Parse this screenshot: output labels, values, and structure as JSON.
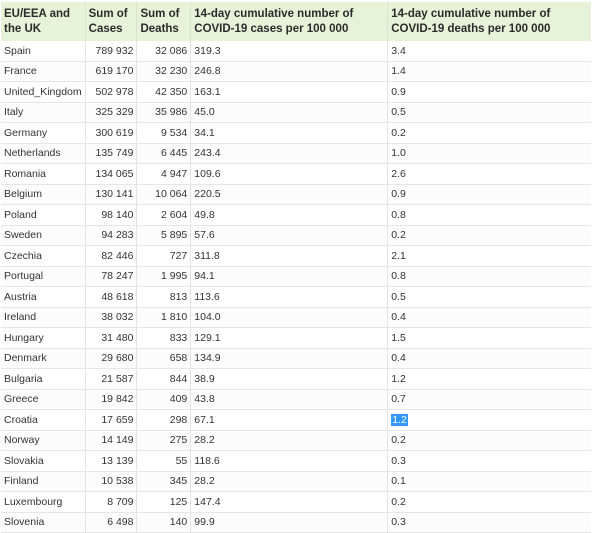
{
  "headers": {
    "country": "EU/EEA and the UK",
    "cases": "Sum of Cases",
    "deaths": "Sum of Deaths",
    "cases_rate": "14-day cumulative number of COVID-19 cases per 100 000",
    "deaths_rate": "14-day cumulative number of COVID-19 deaths per 100 000"
  },
  "rows": [
    {
      "country": "Spain",
      "cases": "789 932",
      "deaths": "32 086",
      "cases_rate": "319.3",
      "deaths_rate": "3.4"
    },
    {
      "country": "France",
      "cases": "619 170",
      "deaths": "32 230",
      "cases_rate": "246.8",
      "deaths_rate": "1.4"
    },
    {
      "country": "United_Kingdom",
      "cases": "502 978",
      "deaths": "42 350",
      "cases_rate": "163.1",
      "deaths_rate": "0.9"
    },
    {
      "country": "Italy",
      "cases": "325 329",
      "deaths": "35 986",
      "cases_rate": "45.0",
      "deaths_rate": "0.5"
    },
    {
      "country": "Germany",
      "cases": "300 619",
      "deaths": "9 534",
      "cases_rate": "34.1",
      "deaths_rate": "0.2"
    },
    {
      "country": "Netherlands",
      "cases": "135 749",
      "deaths": "6 445",
      "cases_rate": "243.4",
      "deaths_rate": "1.0"
    },
    {
      "country": "Romania",
      "cases": "134 065",
      "deaths": "4 947",
      "cases_rate": "109.6",
      "deaths_rate": "2.6"
    },
    {
      "country": "Belgium",
      "cases": "130 141",
      "deaths": "10 064",
      "cases_rate": "220.5",
      "deaths_rate": "0.9"
    },
    {
      "country": "Poland",
      "cases": "98 140",
      "deaths": "2 604",
      "cases_rate": "49.8",
      "deaths_rate": "0.8"
    },
    {
      "country": "Sweden",
      "cases": "94 283",
      "deaths": "5 895",
      "cases_rate": "57.6",
      "deaths_rate": "0.2"
    },
    {
      "country": "Czechia",
      "cases": "82 446",
      "deaths": "727",
      "cases_rate": "311.8",
      "deaths_rate": "2.1"
    },
    {
      "country": "Portugal",
      "cases": "78 247",
      "deaths": "1 995",
      "cases_rate": "94.1",
      "deaths_rate": "0.8"
    },
    {
      "country": "Austria",
      "cases": "48 618",
      "deaths": "813",
      "cases_rate": "113.6",
      "deaths_rate": "0.5"
    },
    {
      "country": "Ireland",
      "cases": "38 032",
      "deaths": "1 810",
      "cases_rate": "104.0",
      "deaths_rate": "0.4"
    },
    {
      "country": "Hungary",
      "cases": "31 480",
      "deaths": "833",
      "cases_rate": "129.1",
      "deaths_rate": "1.5"
    },
    {
      "country": "Denmark",
      "cases": "29 680",
      "deaths": "658",
      "cases_rate": "134.9",
      "deaths_rate": "0.4"
    },
    {
      "country": "Bulgaria",
      "cases": "21 587",
      "deaths": "844",
      "cases_rate": "38.9",
      "deaths_rate": "1.2"
    },
    {
      "country": "Greece",
      "cases": "19 842",
      "deaths": "409",
      "cases_rate": "43.8",
      "deaths_rate": "0.7"
    },
    {
      "country": "Croatia",
      "cases": "17 659",
      "deaths": "298",
      "cases_rate": "67.1",
      "deaths_rate": "1.2"
    },
    {
      "country": "Norway",
      "cases": "14 149",
      "deaths": "275",
      "cases_rate": "28.2",
      "deaths_rate": "0.2"
    },
    {
      "country": "Slovakia",
      "cases": "13 139",
      "deaths": "55",
      "cases_rate": "118.6",
      "deaths_rate": "0.3"
    },
    {
      "country": "Finland",
      "cases": "10 538",
      "deaths": "345",
      "cases_rate": "28.2",
      "deaths_rate": "0.1"
    },
    {
      "country": "Luxembourg",
      "cases": "8 709",
      "deaths": "125",
      "cases_rate": "147.4",
      "deaths_rate": "0.2"
    },
    {
      "country": "Slovenia",
      "cases": "6 498",
      "deaths": "140",
      "cases_rate": "99.9",
      "deaths_rate": "0.3"
    }
  ],
  "selection": {
    "row": 18,
    "column": "deaths_rate"
  },
  "colors": {
    "header_bg": "#e8f2d9",
    "selection_bg": "#3399ff"
  }
}
